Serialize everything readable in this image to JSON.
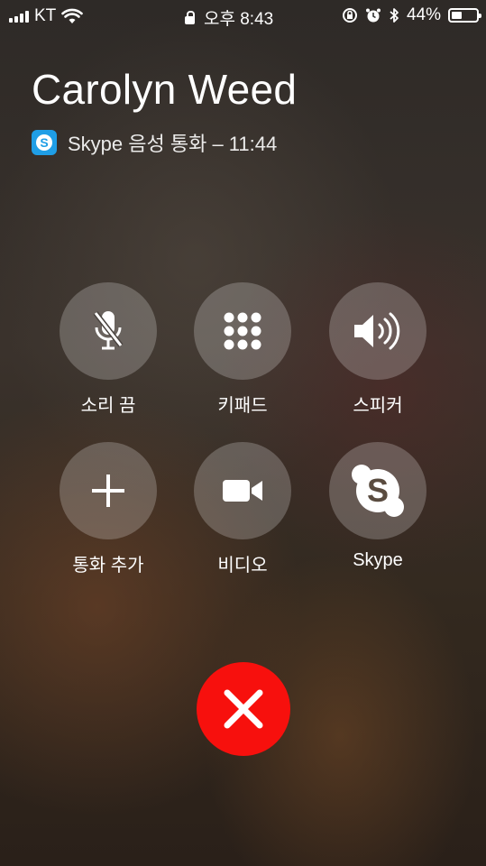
{
  "status_bar": {
    "carrier": "KT",
    "time": "오후 8:43",
    "battery_percent": "44%",
    "battery_level": 0.44
  },
  "call": {
    "caller_name": "Carolyn Weed",
    "call_info": "Skype 음성 통화 – 11:44"
  },
  "controls": [
    {
      "label": "소리 끔",
      "icon": "mute-icon"
    },
    {
      "label": "키패드",
      "icon": "keypad-icon"
    },
    {
      "label": "스피커",
      "icon": "speaker-icon"
    },
    {
      "label": "통화 추가",
      "icon": "add-call-icon"
    },
    {
      "label": "비디오",
      "icon": "video-icon"
    },
    {
      "label": "Skype",
      "icon": "skype-icon"
    }
  ],
  "end_call": {
    "icon": "end-call-icon",
    "color": "#f7100d"
  },
  "colors": {
    "skype_blue": "#1f9ee6",
    "end_call_red": "#f7100d"
  }
}
